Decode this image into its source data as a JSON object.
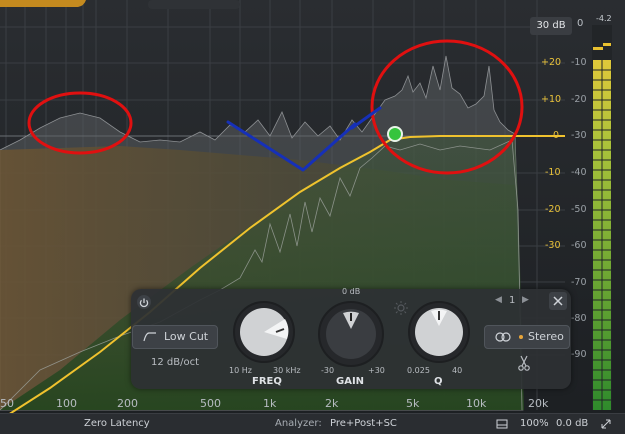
{
  "analyzer_range": "30 dB",
  "meter": {
    "zero": "0",
    "peak": "-4.2",
    "labels": [
      "-10",
      "-20",
      "-30",
      "-40",
      "-50",
      "-60",
      "-70",
      "-80",
      "-90"
    ],
    "level": 0.84
  },
  "gain_scale": [
    "+20",
    "+10",
    "0",
    "-10",
    "-20",
    "-30"
  ],
  "analyzer_scale": [
    "-10",
    "-20",
    "-30",
    "-40",
    "-50",
    "-60"
  ],
  "freq_labels": [
    "50",
    "100",
    "200",
    "500",
    "1k",
    "2k",
    "5k",
    "10k",
    "20k"
  ],
  "band_panel": {
    "filter_type": "Low Cut",
    "slope": "12 dB/oct",
    "freq": {
      "label": "FREQ",
      "min": "10 Hz",
      "max": "30 kHz"
    },
    "gain": {
      "label": "GAIN",
      "min": "-30",
      "max": "+30",
      "center": "0 dB"
    },
    "q": {
      "label": "Q",
      "min": "0.025",
      "max": "40"
    },
    "band_number": "1",
    "channel_mode": "Stereo"
  },
  "status": {
    "latency": "Zero Latency",
    "analyzer_label": "Analyzer:",
    "analyzer_value": "Pre+Post+SC",
    "zoom": "100%",
    "output_gain": "0.0 dB"
  },
  "colors": {
    "curve": "#f0c22e",
    "annotation_circle": "#e01010",
    "annotation_v": "#1630b8",
    "band_handle": "#35c43d"
  }
}
